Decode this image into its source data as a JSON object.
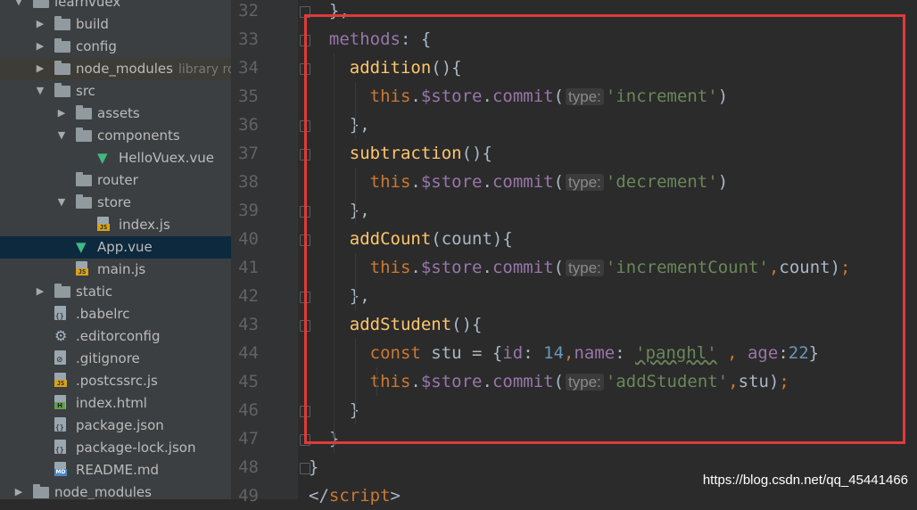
{
  "project_tree": [
    {
      "label": "learnvuex",
      "icon": "folder-icon",
      "arrow": "open",
      "depth": 0
    },
    {
      "label": "build",
      "icon": "folder-icon",
      "arrow": "closed",
      "depth": 1
    },
    {
      "label": "config",
      "icon": "folder-icon",
      "arrow": "closed",
      "depth": 1
    },
    {
      "label": "node_modules",
      "note": "library root",
      "icon": "folder-icon",
      "arrow": "closed",
      "depth": 1
    },
    {
      "label": "src",
      "icon": "folder-icon",
      "arrow": "open",
      "depth": 1
    },
    {
      "label": "assets",
      "icon": "folder-icon",
      "arrow": "closed",
      "depth": 2
    },
    {
      "label": "components",
      "icon": "folder-icon",
      "arrow": "open",
      "depth": 2
    },
    {
      "label": "HelloVuex.vue",
      "icon": "vue-file-icon",
      "arrow": "none",
      "depth": 3
    },
    {
      "label": "router",
      "icon": "folder-icon",
      "arrow": "none",
      "depth": 2
    },
    {
      "label": "store",
      "icon": "folder-icon",
      "arrow": "open",
      "depth": 2
    },
    {
      "label": "index.js",
      "icon": "js-file-icon",
      "arrow": "none",
      "depth": 3
    },
    {
      "label": "App.vue",
      "icon": "vue-file-icon",
      "arrow": "none",
      "depth": 2
    },
    {
      "label": "main.js",
      "icon": "js-file-icon",
      "arrow": "none",
      "depth": 2
    },
    {
      "label": "static",
      "icon": "folder-icon",
      "arrow": "closed",
      "depth": 1
    },
    {
      "label": ".babelrc",
      "icon": "json-file-icon",
      "arrow": "none",
      "depth": 1
    },
    {
      "label": ".editorconfig",
      "icon": "gear-icon",
      "arrow": "none",
      "depth": 1
    },
    {
      "label": ".gitignore",
      "icon": "ignore-file-icon",
      "arrow": "none",
      "depth": 1
    },
    {
      "label": ".postcssrc.js",
      "icon": "js-file-icon",
      "arrow": "none",
      "depth": 1
    },
    {
      "label": "index.html",
      "icon": "html-file-icon",
      "arrow": "none",
      "depth": 1
    },
    {
      "label": "package.json",
      "icon": "json-file-icon",
      "arrow": "none",
      "depth": 1
    },
    {
      "label": "package-lock.json",
      "icon": "json-file-icon",
      "arrow": "none",
      "depth": 1
    },
    {
      "label": "README.md",
      "icon": "md-file-icon",
      "arrow": "none",
      "depth": 1
    },
    {
      "label": "node_modules",
      "icon": "folder-icon",
      "arrow": "closed",
      "depth": 0
    }
  ],
  "badges": {
    "js": "JS",
    "html": "H",
    "md": "MD",
    "json": "{}"
  },
  "line_numbers": [
    "32",
    "33",
    "34",
    "35",
    "36",
    "37",
    "38",
    "39",
    "40",
    "41",
    "42",
    "43",
    "44",
    "45",
    "46",
    "47",
    "48",
    "49"
  ],
  "code_lines": [
    [
      {
        "t": "  },",
        "c": "p"
      }
    ],
    [
      {
        "t": "  ",
        "c": "p"
      },
      {
        "t": "methods",
        "c": "pr"
      },
      {
        "t": ": {",
        "c": "p"
      }
    ],
    [
      {
        "t": "    ",
        "c": "p"
      },
      {
        "t": "addition",
        "c": "fn"
      },
      {
        "t": "(){",
        "c": "p"
      }
    ],
    [
      {
        "t": "      ",
        "c": "p"
      },
      {
        "t": "this",
        "c": "kw"
      },
      {
        "t": ".",
        "c": "p"
      },
      {
        "t": "$store",
        "c": "pr"
      },
      {
        "t": ".",
        "c": "p"
      },
      {
        "t": "commit",
        "c": "pr"
      },
      {
        "t": "(",
        "c": "p"
      },
      {
        "t": "type:",
        "c": "hint"
      },
      {
        "t": "'increment'",
        "c": "st"
      },
      {
        "t": ")",
        "c": "p"
      }
    ],
    [
      {
        "t": "    ",
        "c": "p"
      },
      {
        "t": "},",
        "c": "p"
      }
    ],
    [
      {
        "t": "    ",
        "c": "p"
      },
      {
        "t": "subtraction",
        "c": "fn"
      },
      {
        "t": "(){",
        "c": "p"
      }
    ],
    [
      {
        "t": "      ",
        "c": "p"
      },
      {
        "t": "this",
        "c": "kw"
      },
      {
        "t": ".",
        "c": "p"
      },
      {
        "t": "$store",
        "c": "pr"
      },
      {
        "t": ".",
        "c": "p"
      },
      {
        "t": "commit",
        "c": "pr"
      },
      {
        "t": "(",
        "c": "p"
      },
      {
        "t": "type:",
        "c": "hint"
      },
      {
        "t": "'decrement'",
        "c": "st"
      },
      {
        "t": ")",
        "c": "p"
      }
    ],
    [
      {
        "t": "    ",
        "c": "p"
      },
      {
        "t": "},",
        "c": "p"
      }
    ],
    [
      {
        "t": "    ",
        "c": "p"
      },
      {
        "t": "addCount",
        "c": "fn"
      },
      {
        "t": "(count){",
        "c": "p"
      }
    ],
    [
      {
        "t": "      ",
        "c": "p"
      },
      {
        "t": "this",
        "c": "kw"
      },
      {
        "t": ".",
        "c": "p"
      },
      {
        "t": "$store",
        "c": "pr"
      },
      {
        "t": ".",
        "c": "p"
      },
      {
        "t": "commit",
        "c": "pr"
      },
      {
        "t": "(",
        "c": "p"
      },
      {
        "t": "type:",
        "c": "hint"
      },
      {
        "t": "'incrementCount'",
        "c": "st"
      },
      {
        "t": ",",
        "c": "kw"
      },
      {
        "t": "count)",
        "c": "p"
      },
      {
        "t": ";",
        "c": "kw"
      }
    ],
    [
      {
        "t": "    ",
        "c": "p"
      },
      {
        "t": "},",
        "c": "p"
      }
    ],
    [
      {
        "t": "    ",
        "c": "p"
      },
      {
        "t": "addStudent",
        "c": "fn"
      },
      {
        "t": "(){",
        "c": "p"
      }
    ],
    [
      {
        "t": "      ",
        "c": "p"
      },
      {
        "t": "const ",
        "c": "kw"
      },
      {
        "t": "stu = {",
        "c": "p"
      },
      {
        "t": "id",
        "c": "pr"
      },
      {
        "t": ": ",
        "c": "p"
      },
      {
        "t": "14",
        "c": "nm"
      },
      {
        "t": ",",
        "c": "kw"
      },
      {
        "t": "name",
        "c": "pr"
      },
      {
        "t": ": ",
        "c": "p"
      },
      {
        "t": "'panghl'",
        "c": "st squig"
      },
      {
        "t": " , ",
        "c": "kw"
      },
      {
        "t": "age",
        "c": "pr"
      },
      {
        "t": ":",
        "c": "p"
      },
      {
        "t": "22",
        "c": "nm"
      },
      {
        "t": "}",
        "c": "p"
      }
    ],
    [
      {
        "t": "      ",
        "c": "p"
      },
      {
        "t": "this",
        "c": "kw"
      },
      {
        "t": ".",
        "c": "p"
      },
      {
        "t": "$store",
        "c": "pr"
      },
      {
        "t": ".",
        "c": "p"
      },
      {
        "t": "commit",
        "c": "pr"
      },
      {
        "t": "(",
        "c": "p"
      },
      {
        "t": "type:",
        "c": "hint"
      },
      {
        "t": "'addStudent'",
        "c": "st"
      },
      {
        "t": ",",
        "c": "kw"
      },
      {
        "t": "stu)",
        "c": "p"
      },
      {
        "t": ";",
        "c": "kw"
      }
    ],
    [
      {
        "t": "    ",
        "c": "p"
      },
      {
        "t": "}",
        "c": "p"
      }
    ],
    [
      {
        "t": "  ",
        "c": "p"
      },
      {
        "t": "}",
        "c": "p"
      }
    ],
    [
      {
        "t": "}",
        "c": "p"
      }
    ],
    [
      {
        "t": "</",
        "c": "p"
      },
      {
        "t": "script",
        "c": "kw"
      },
      {
        "t": ">",
        "c": "p"
      }
    ]
  ],
  "watermark": "https://blog.csdn.net/qq_45441466",
  "colors": {
    "highlight_box": "#e03a3a",
    "editor_bg": "#2b2b2b",
    "sidebar_bg": "#3c3f41",
    "selection": "#0d293e"
  }
}
